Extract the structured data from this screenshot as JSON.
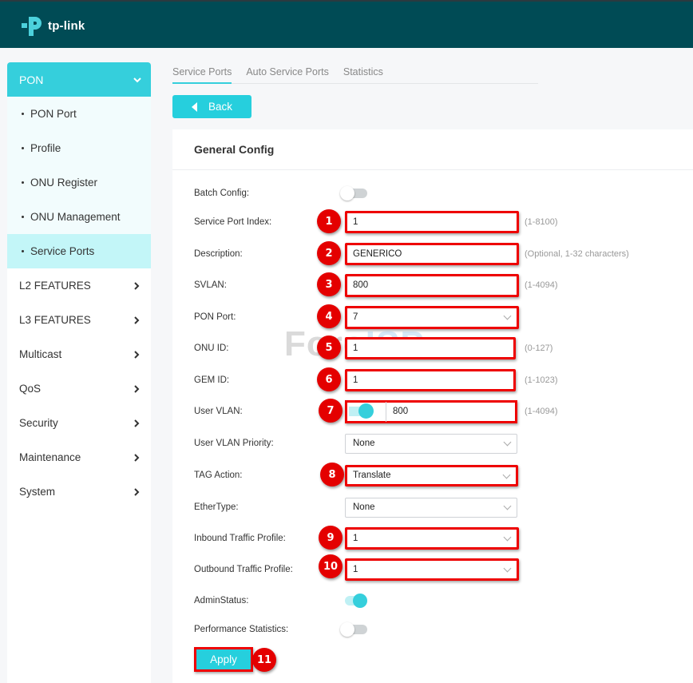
{
  "brand": {
    "logo_text": "tp-link",
    "accent": "#35cfdc",
    "header_bg": "#004b55"
  },
  "sidebar": {
    "open_group": "PON",
    "sub_items": [
      {
        "label": "PON Port",
        "active": false
      },
      {
        "label": "Profile",
        "active": false
      },
      {
        "label": "ONU Register",
        "active": false
      },
      {
        "label": "ONU Management",
        "active": false
      },
      {
        "label": "Service Ports",
        "active": true
      }
    ],
    "items": [
      {
        "label": "L2 FEATURES"
      },
      {
        "label": "L3 FEATURES"
      },
      {
        "label": "Multicast"
      },
      {
        "label": "QoS"
      },
      {
        "label": "Security"
      },
      {
        "label": "Maintenance"
      },
      {
        "label": "System"
      }
    ]
  },
  "tabs": [
    {
      "label": "Service Ports",
      "active": true
    },
    {
      "label": "Auto Service Ports",
      "active": false
    },
    {
      "label": "Statistics",
      "active": false
    }
  ],
  "back_label": "Back",
  "panel": {
    "title": "General Config",
    "batch_config": {
      "label": "Batch Config:",
      "on": false
    },
    "service_port_index": {
      "label": "Service Port Index:",
      "value": "1",
      "hint": "(1-8100)",
      "badge": "1"
    },
    "description": {
      "label": "Description:",
      "value": "GENERICO",
      "hint": "(Optional, 1-32 characters)",
      "badge": "2"
    },
    "svlan": {
      "label": "SVLAN:",
      "value": "800",
      "hint": "(1-4094)",
      "badge": "3"
    },
    "pon_port": {
      "label": "PON Port:",
      "value": "7",
      "badge": "4"
    },
    "onu_id": {
      "label": "ONU ID:",
      "value": "1",
      "hint": "(0-127)",
      "badge": "5"
    },
    "gem_id": {
      "label": "GEM ID:",
      "value": "1",
      "hint": "(1-1023)",
      "badge": "6"
    },
    "user_vlan": {
      "label": "User VLAN:",
      "value": "800",
      "hint": "(1-4094)",
      "badge": "7",
      "enabled": true
    },
    "user_vlan_priority": {
      "label": "User VLAN Priority:",
      "value": "None"
    },
    "tag_action": {
      "label": "TAG Action:",
      "value": "Translate",
      "badge": "8"
    },
    "ether_type": {
      "label": "EtherType:",
      "value": "None"
    },
    "inbound_profile": {
      "label": "Inbound Traffic Profile:",
      "value": "1",
      "badge": "9"
    },
    "outbound_profile": {
      "label": "Outbound Traffic Profile:",
      "value": "1",
      "badge": "10"
    },
    "admin_status": {
      "label": "AdminStatus:",
      "on": true
    },
    "performance_statistics": {
      "label": "Performance Statistics:",
      "on": false
    },
    "apply_label": "Apply",
    "apply_badge": "11"
  },
  "watermark": {
    "part1": "Foro",
    "part2": "ISP"
  }
}
